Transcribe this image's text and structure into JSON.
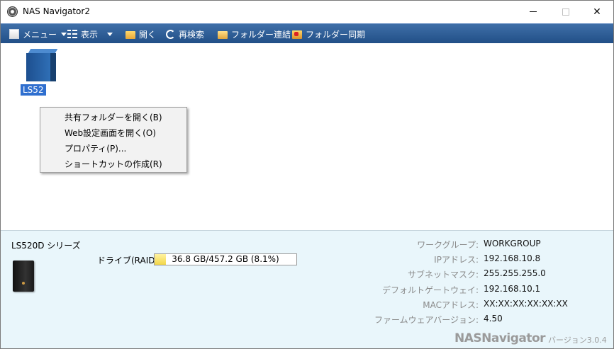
{
  "window": {
    "title": "NAS Navigator2",
    "minimize_glyph": "—",
    "maximize_glyph": "☐",
    "close_glyph": "✕"
  },
  "toolbar": {
    "menu": "メニュー",
    "view": "表示",
    "open": "開く",
    "rescan": "再検索",
    "folder_link": "フォルダー連結",
    "folder_sync": "フォルダー同期",
    "icons": [
      "menu-icon",
      "view-icon",
      "folder-open-icon",
      "refresh-icon",
      "folder-link-icon",
      "folder-sync-icon"
    ]
  },
  "device_tile": {
    "label": "LS52",
    "icon": "nas-device-icon",
    "selected": true
  },
  "context_menu": {
    "items": [
      "共有フォルダーを開く(B)",
      "Web設定画面を開く(O)",
      "プロパティ(P)...",
      "ショートカットの作成(R)"
    ]
  },
  "info": {
    "model": "LS520D シリーズ",
    "drive_label": "ドライブ(RAID1)",
    "drive_usage_text": "36.8 GB/457.2 GB (8.1%)",
    "drive_usage_fraction": 0.081,
    "workgroup_label": "ワークグループ:",
    "workgroup": "WORKGROUP",
    "ip_label": "IPアドレス:",
    "ip": "192.168.10.8",
    "subnet_label": "サブネットマスク:",
    "subnet": "255.255.255.0",
    "gateway_label": "デフォルトゲートウェイ:",
    "gateway": "192.168.10.1",
    "mac_label": "MACアドレス:",
    "mac": "XX:XX:XX:XX:XX:XX",
    "firmware_label": "ファームウェアバージョン:",
    "firmware": "4.50",
    "brand": "NASNavigator",
    "version": "バージョン3.0.4"
  },
  "colors": {
    "toolbar_top": "#3f6fa8",
    "toolbar_bottom": "#214f87",
    "selection": "#2f6fcf",
    "info_panel": "#e9f6fb",
    "drive_fill": "#f2d649"
  }
}
